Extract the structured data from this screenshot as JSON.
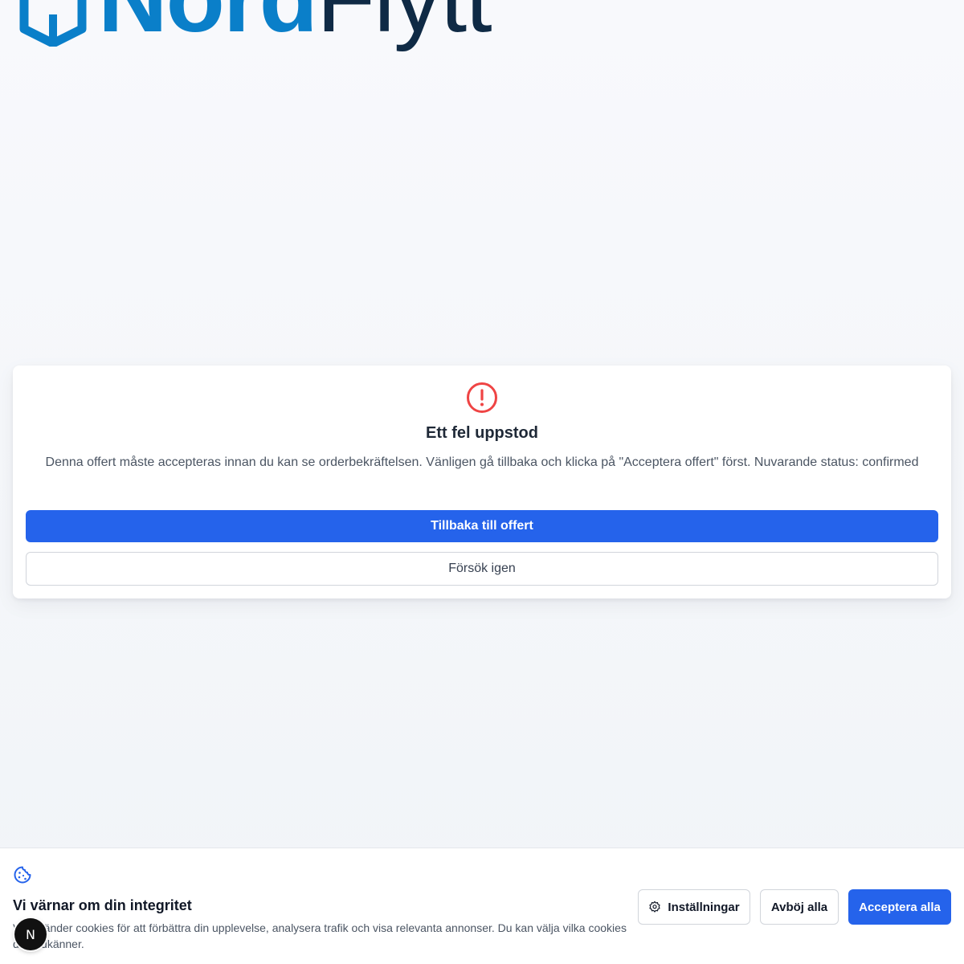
{
  "brand": {
    "logo_text_primary": "Nord",
    "logo_text_secondary": "Flytt",
    "primary_color": "#0a7fc9",
    "secondary_color": "#0f2a45"
  },
  "error_card": {
    "icon": "alert-circle-icon",
    "title": "Ett fel uppstod",
    "message": "Denna offert måste accepteras innan du kan se orderbekräftelsen. Vänligen gå tillbaka och klicka på \"Acceptera offert\" först. Nuvarande status: confirmed",
    "primary_button": "Tillbaka till offert",
    "secondary_button": "Försök igen",
    "accent_color": "#2563eb",
    "error_color": "#ef4444"
  },
  "cookie_banner": {
    "icon": "cookie-icon",
    "title": "Vi värnar om din integritet",
    "text": "Vi använder cookies för att förbättra din upplevelse, analysera trafik och visa relevanta annonser. Du kan välja vilka cookies du godkänner.",
    "settings_button": "Inställningar",
    "reject_button": "Avböj alla",
    "accept_button": "Acceptera alla"
  },
  "dev_badge": {
    "label": "N",
    "icon": "nextjs-icon"
  }
}
